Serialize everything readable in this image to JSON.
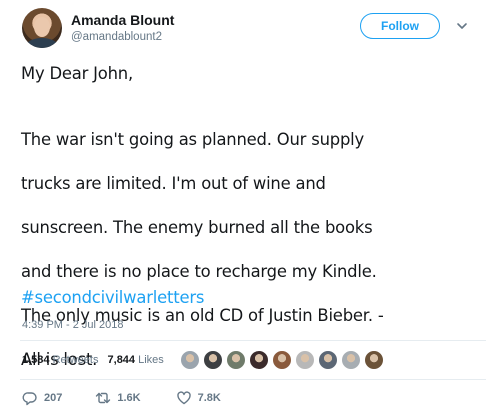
{
  "user": {
    "display_name": "Amanda Blount",
    "handle": "@amandablount2",
    "avatar_icon": "user-avatar"
  },
  "follow_label": "Follow",
  "tweet": {
    "greeting": "My Dear John,",
    "body_lines": [
      "The war isn't going as planned. Our supply",
      "trucks are limited. I'm out of wine and",
      "sunscreen. The enemy burned all the books",
      "and there is no place to recharge my Kindle.",
      "The only music is an old CD of Justin Bieber. -",
      "All is lost."
    ],
    "hashtag": "#secondcivilwarletters"
  },
  "timestamp": "4:39 PM - 2 Jul 2018",
  "stats": {
    "retweets_count": "1,584",
    "retweets_label": "Retweets",
    "likes_count": "7,844",
    "likes_label": "Likes"
  },
  "likers": [
    {
      "color": "#9aa4ad"
    },
    {
      "color": "#3d3f42"
    },
    {
      "color": "#6f7b6a"
    },
    {
      "color": "#3b2b2b"
    },
    {
      "color": "#8a5a3c"
    },
    {
      "color": "#b8b8b8"
    },
    {
      "color": "#5c6775"
    },
    {
      "color": "#a7adb2"
    },
    {
      "color": "#6b5238"
    }
  ],
  "actions": {
    "reply_count": "207",
    "retweet_count": "1.6K",
    "like_count": "7.8K"
  },
  "colors": {
    "accent": "#1da1f2",
    "muted": "#657786",
    "text": "#14171a"
  }
}
